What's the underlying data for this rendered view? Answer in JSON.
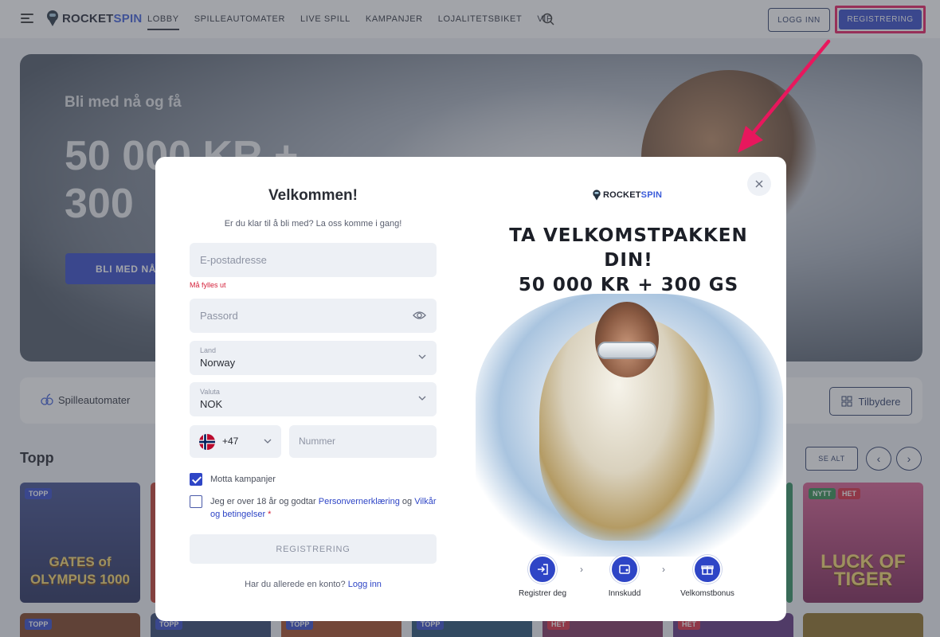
{
  "header": {
    "logo_text_a": "ROCKET",
    "logo_text_b": "SPIN",
    "nav": [
      {
        "label": "Lobby"
      },
      {
        "label": "Spilleautomater"
      },
      {
        "label": "Live spill"
      },
      {
        "label": "Kampanjer"
      },
      {
        "label": "Lojalitetsbiket"
      },
      {
        "label": "VIP"
      }
    ],
    "login_label": "Logg inn",
    "register_label": "Registrering"
  },
  "hero": {
    "subtitle": "Bli med nå og få",
    "title_line1": "50 000 KR +",
    "title_line2": "300",
    "cta": "Bli med nå"
  },
  "category_bar": {
    "slots_label": "Spilleautomater",
    "providers_label": "Tilbydere"
  },
  "section": {
    "title": "Topp",
    "see_all": "Se alt"
  },
  "games": [
    {
      "tags": [
        "TOPP"
      ],
      "title": "GATES of OLYMPUS 1000"
    },
    {
      "tags": [
        "NYTT",
        "HET"
      ],
      "title": "LUCK OF TIGER"
    }
  ],
  "lower_tags": [
    "TOPP",
    "TOPP",
    "TOPP",
    "TOPP",
    "HET",
    "HET"
  ],
  "modal": {
    "title": "Velkommen!",
    "subtitle": "Er du klar til å bli med? La oss komme i gang!",
    "email_placeholder": "E-postadresse",
    "email_error": "Må fylles ut",
    "password_placeholder": "Passord",
    "country_label": "Land",
    "country_value": "Norway",
    "currency_label": "Valuta",
    "currency_value": "NOK",
    "phone_code": "+47",
    "phone_placeholder": "Nummer",
    "promo_checkbox": {
      "label": "Motta kampanjer",
      "checked": true
    },
    "terms_checkbox": {
      "checked": false,
      "text_a": "Jeg er over 18 år og godtar ",
      "link_a": "Personvernerklæring",
      "text_b": " og ",
      "link_b": "Vilkår og betingelser",
      "required": " *"
    },
    "register_button": "REGISTRERING",
    "have_account": "Har du allerede en konto? ",
    "login_link": "Logg inn"
  },
  "promo": {
    "logo_a": "ROCKET",
    "logo_b": "SPIN",
    "headline_1": "TA VELKOMSTPAKKEN",
    "headline_2": "DIN!",
    "headline_3": "50 000 KR + 300 GS",
    "steps": [
      {
        "label": "Registrer deg",
        "icon": "login-icon"
      },
      {
        "label": "Innskudd",
        "icon": "wallet-icon"
      },
      {
        "label": "Velkomstbonus",
        "icon": "gift-icon"
      }
    ]
  },
  "colors": {
    "brand_blue": "#2e45c6",
    "highlight_pink": "#e8175d",
    "error_red": "#d4203a"
  }
}
